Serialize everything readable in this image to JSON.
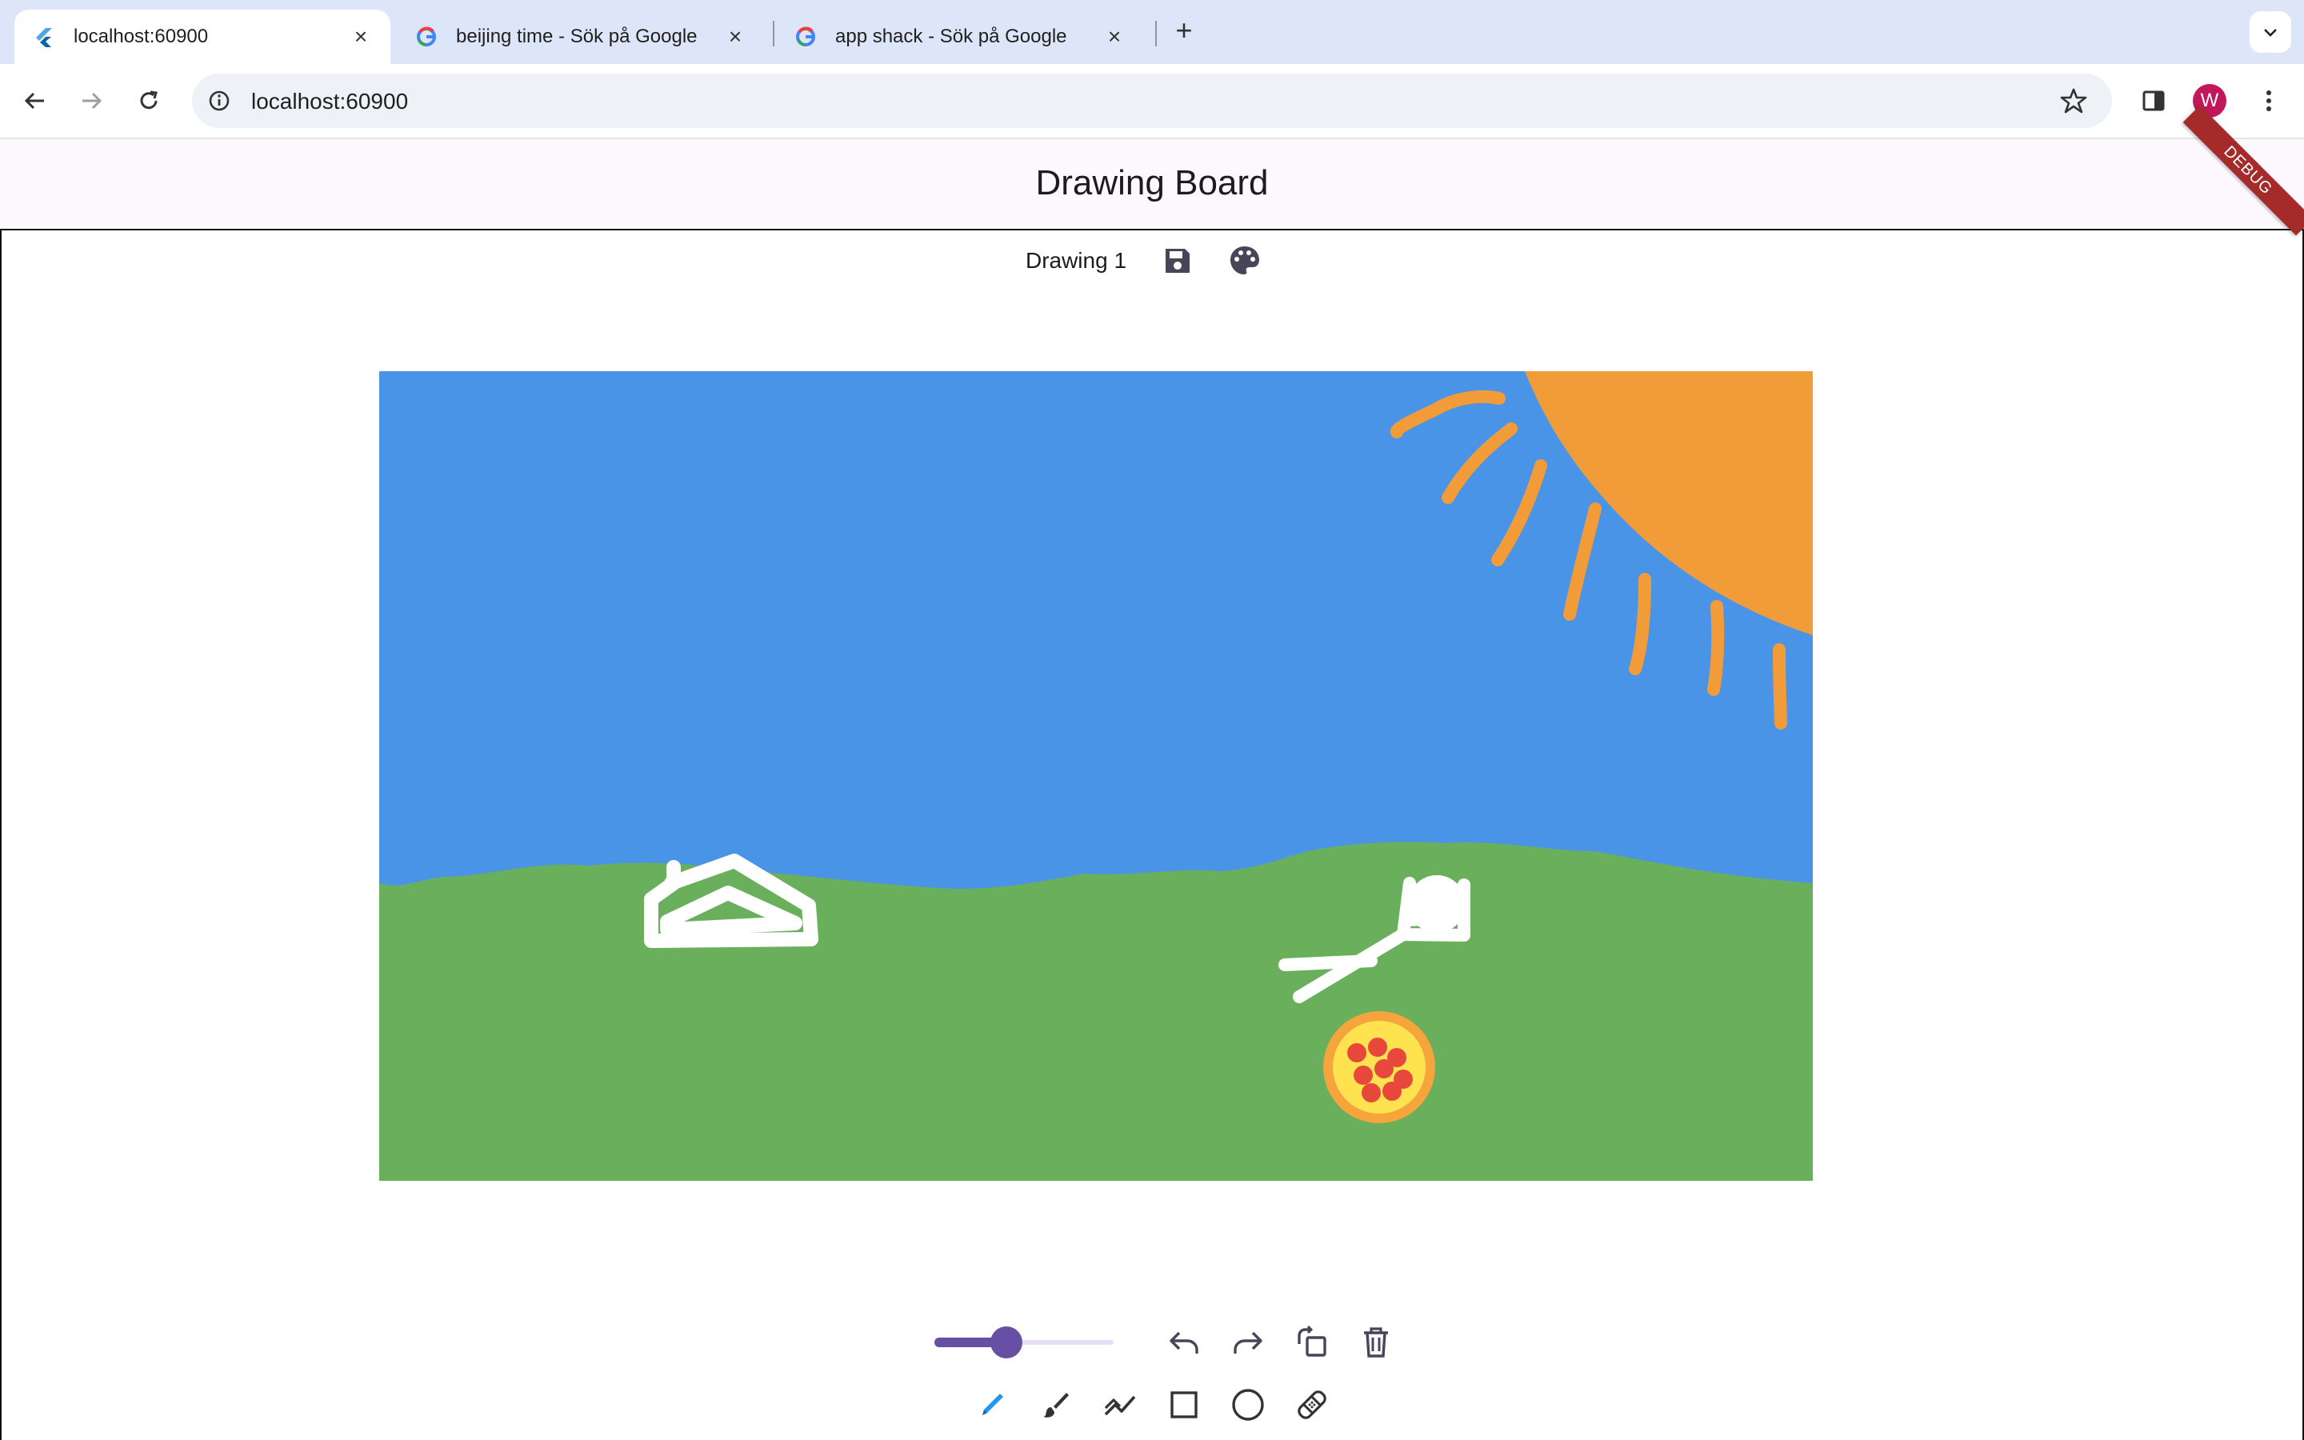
{
  "browser": {
    "tabs": [
      {
        "title": "localhost:60900",
        "icon": "flutter-icon",
        "active": true
      },
      {
        "title": "beijing time - Sök på Google",
        "icon": "google-icon",
        "active": false
      },
      {
        "title": "app shack - Sök på Google",
        "icon": "google-icon",
        "active": false
      }
    ],
    "url": "localhost:60900",
    "profile_initial": "W",
    "profile_color": "#c2185b"
  },
  "app": {
    "title": "Drawing Board",
    "debug_banner": "DEBUG",
    "drawing_name": "Drawing 1",
    "stroke_size": 0.4,
    "selected_tool": "pencil",
    "accent_color": "#6750a4",
    "selected_tool_color": "#2196f3",
    "canvas": {
      "sky_color": "#4a94e8",
      "grass_color": "#6aaf5c",
      "sun_color": "#f19c38",
      "drawing_color": "#ffffff"
    },
    "tools": [
      "pencil-icon",
      "brush-icon",
      "polyline-icon",
      "rectangle-icon",
      "circle-icon",
      "eraser-icon"
    ],
    "actions": [
      "undo-icon",
      "redo-icon",
      "rotate-icon",
      "delete-icon"
    ]
  }
}
